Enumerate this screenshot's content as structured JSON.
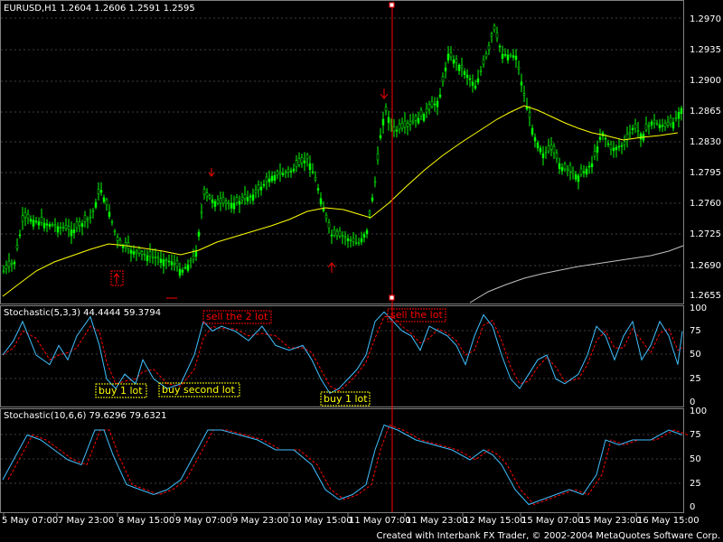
{
  "header": {
    "main_info": "EURUSD,H1  1.2604 1.2606 1.2591 1.2595",
    "stoch1_info": "Stochastic(5,3,3)  44.4444  59.3794",
    "stoch2_info": "Stochastic(10,6,6)  79.6296  79.6321"
  },
  "axes": {
    "price_ticks": [
      "1.2970",
      "1.2935",
      "1.2900",
      "1.2865",
      "1.2830",
      "1.2795",
      "1.2760",
      "1.2725",
      "1.2690",
      "1.2655"
    ],
    "stoch1_ticks": [
      "100",
      "75",
      "50",
      "25",
      "0"
    ],
    "stoch2_ticks": [
      "100",
      "75",
      "50",
      "25",
      "0"
    ],
    "time_ticks": [
      "5 May 07:00",
      "7 May 23:00",
      "8 May 15:00",
      "9 May 07:00",
      "9 May 23:00",
      "10 May 15:00",
      "11 May 07:00",
      "11 May 23:00",
      "12 May 15:00",
      "15 May 07:00",
      "15 May 23:00",
      "16 May 15:00"
    ]
  },
  "annotations": {
    "sell_2_lot": "sell the 2 lot",
    "sell_lot": "sell the lot",
    "buy_1_lot_a": "buy 1 lot",
    "buy_second_lot": "buy second lot",
    "buy_1_lot_b": "buy 1 lot"
  },
  "footer": "Created with Interbank FX Trader, © 2002-2004 MetaQuotes Software Corp.",
  "colors": {
    "background": "#000000",
    "candles": "#00ff00",
    "ma_fast": "#ffff00",
    "ma_slow": "#c0c0c0",
    "stoch_main": "#40c0ff",
    "stoch_signal": "#ff0000",
    "vertical_marker": "#ff0000",
    "sell_label": "#ff0000",
    "buy_label": "#ffff00"
  },
  "icons": {
    "sell_arrow": "down-arrow-icon",
    "buy_arrow": "up-arrow-icon"
  }
}
